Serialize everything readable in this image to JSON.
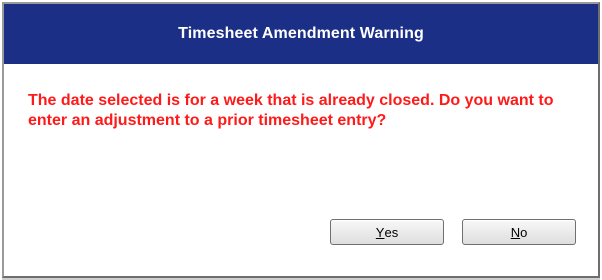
{
  "dialog": {
    "title": "Timesheet Amendment Warning",
    "message": "The date selected is for a week that is already closed. Do you want to enter an adjustment to a prior timesheet entry?",
    "buttons": {
      "yes": {
        "accel": "Y",
        "rest": "es"
      },
      "no": {
        "accel": "N",
        "rest": "o"
      }
    }
  },
  "colors": {
    "title_bar": "#1c2f87",
    "title_text": "#ffffff",
    "message_text": "#ff1a1a"
  }
}
